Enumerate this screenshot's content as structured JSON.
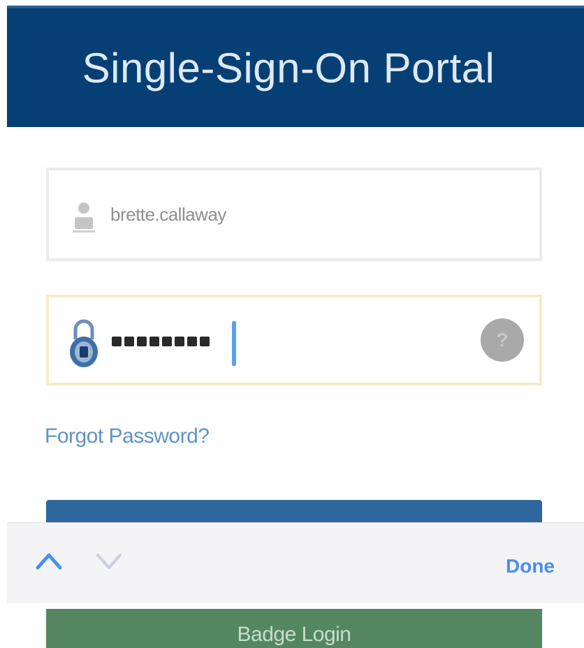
{
  "header": {
    "title": "Single-Sign-On Portal"
  },
  "form": {
    "username": {
      "value": "brette.callaway",
      "icon": "user-icon"
    },
    "password": {
      "masked_length": 8,
      "icon": "lock-icon",
      "help_icon": "help-icon"
    },
    "forgot_link": "Forgot Password?",
    "badge_login_label": "Badge Login"
  },
  "keyboard_toolbar": {
    "prev_icon": "chevron-up-icon",
    "next_icon": "chevron-down-icon",
    "done_label": "Done"
  },
  "colors": {
    "header_bg": "#053f74",
    "link": "#5e93c8",
    "badge_bg": "#548761",
    "focus_border": "#f8ecc6"
  }
}
